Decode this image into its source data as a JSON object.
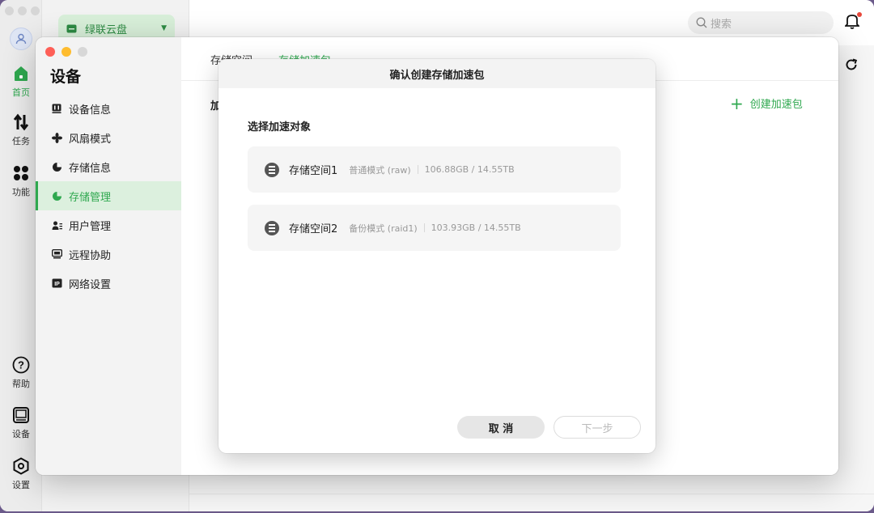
{
  "app": {
    "device_name": "绿联云盘",
    "search_placeholder": "搜索"
  },
  "nav_rail": {
    "items": [
      {
        "label": "首页",
        "icon": "home-icon",
        "active": true
      },
      {
        "label": "任务",
        "icon": "transfer-icon",
        "active": false
      },
      {
        "label": "功能",
        "icon": "apps-icon",
        "active": false
      }
    ],
    "bottom_items": [
      {
        "label": "帮助",
        "icon": "help-icon"
      },
      {
        "label": "设备",
        "icon": "device-icon"
      },
      {
        "label": "设置",
        "icon": "settings-icon"
      }
    ]
  },
  "settings": {
    "title": "设备",
    "menu": [
      {
        "label": "设备信息",
        "icon": "device-info-icon"
      },
      {
        "label": "风扇模式",
        "icon": "fan-icon"
      },
      {
        "label": "存储信息",
        "icon": "storage-info-icon"
      },
      {
        "label": "存储管理",
        "icon": "storage-manage-icon",
        "active": true
      },
      {
        "label": "用户管理",
        "icon": "user-manage-icon"
      },
      {
        "label": "远程协助",
        "icon": "remote-icon"
      },
      {
        "label": "网络设置",
        "icon": "network-icon"
      }
    ],
    "tabs": [
      "存储空间",
      "存储加速包"
    ],
    "section_label": "加",
    "create_label": "创建加速包"
  },
  "modal": {
    "title": "确认创建存储加速包",
    "subtitle": "选择加速对象",
    "options": [
      {
        "name": "存储空间1",
        "mode": "普通模式 (raw)",
        "size": "106.88GB / 14.55TB"
      },
      {
        "name": "存储空间2",
        "mode": "备份模式 (raid1)",
        "size": "103.93GB / 14.55TB"
      }
    ],
    "cancel_label": "取 消",
    "next_label": "下一步"
  },
  "colors": {
    "accent": "#2fa84f",
    "accent_bg": "#dcf0de"
  }
}
